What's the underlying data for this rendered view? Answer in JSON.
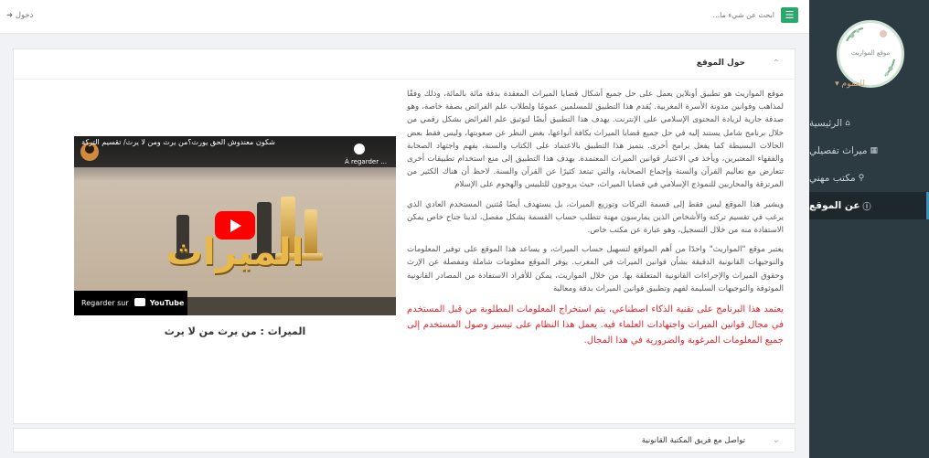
{
  "sidebar": {
    "logo_text": "موقع المواريث",
    "user_name": "للعموم",
    "items": [
      {
        "label": "الرئيسية",
        "icon": "home-icon"
      },
      {
        "label": "ميراث تفصيلي",
        "icon": "calculator-icon"
      },
      {
        "label": "مكتب مهني",
        "icon": "search-icon"
      },
      {
        "label": "عن الموقع",
        "icon": "info-icon",
        "active": true
      }
    ]
  },
  "topbar": {
    "search_placeholder": "ابحث عن شيء ما...",
    "login": "دخول"
  },
  "about": {
    "title": "حول الموقع",
    "paragraphs": [
      "موقع المواريث هو تطبيق أونلاين يعمل على حل جميع أشكال قضايا الميراث المعقدة بدقة مائة بالمائة، وذلك وفقًا لمذاهب وقوانين مدونة الأسرة المغربية. يُقدم هذا التطبيق للمسلمين عمومًا ولطلاب علم الفرائض بصفة خاصة، وهو صدقة جارية لزيادة المحتوى الإسلامي على الإنترنت. يهدف هذا التطبيق أيضًا لتوثيق علم الفرائض بشكل رقمي من خلال برنامج شامل يستند إليه في حل جميع قضايا الميراث بكافة أنواعها، بغض النظر عن صعوبتها، وليس فقط بعض الحالات البسيطة كما يفعل برامج أخرى. يتميز هذا التطبيق بالاعتماد على الكتاب والسنة، بفهم واجتهاد الصحابة والفقهاء المعتبرين، ويأخذ في الاعتبار قوانين الميراث المعتمدة. يهدف هذا التطبيق إلى منع استخدام تطبيقات أخرى تتعارض مع تعاليم القرآن والسنة وإجماع الصحابة، والتي تبتعد كثيرًا عن القرآن والسنة. لاحظ أن هناك الكثير من المرتزقة والمحاربين للنموذج الإسلامي في قضايا الميراث، حيث يروجون للتلبيس والهجوم على الإسلام",
      "ويشير هذا الموقع ليس فقط إلى قسمة التركات وتوزيع الميراث، بل يستهدف أيضًا مُثنين المستخدم العادي الذي يرغب في تقسيم تركته والأشخاص الذين يمارسون مهنة تتطلب حساب القسمة بشكل مفصل، لدينا جناح خاص يمكن الاستفادة منه من خلال التسجيل، وهو عبارة عن مكتب خاص.",
      "يعتبر موقع \"المواريث\" واحدًا من أهم المواقع لتسهيل حساب الميراث، و يساعد هذا الموقع على توفير المعلومات والتوجيهات القانونية الدقيقة بشأن قوانين الميراث في المغرب. يوفر الموقع معلومات شاملة ومفصلة عن الإرث وحقوق الميراث والإجراءات القانونية المتعلقة بها. من خلال المواريث، يمكن للأفراد الاستفادة من المصادر القانونية الموثوقة والتوجيهات السليمة لفهم وتطبيق قوانين الميراث بدقة ومعالية"
    ],
    "red_paragraph": "يعتمد هذا البرنامج على تقنية الذكاء اصطناعي، يتم استخراج المعلومات المطلوبة من قبل المستخدم في مجال قوانين الميراث واجتهادات العلماء فيه. يعمل هذا النظام على تيسير وصول المستخدم إلى جميع المعلومات المرغوبة والضرورية في هذا المجال."
  },
  "video": {
    "title": "شكون معندوش الحق يورث؟من يرث ومن لا يرث/ تقسيم التركة",
    "watch_later": "À regarder ...",
    "watch_on": "Regarder sur",
    "youtube": "YouTube",
    "thumb_text": "الميراث",
    "caption": "الميراث : من يرث من لا يرث"
  },
  "contact": {
    "title": "تواصل مع فريق المكتبة القانونية"
  },
  "colors": {
    "sidebar": "#2c3b41",
    "accent_green": "#2aa76a",
    "red_text": "#e6232a"
  }
}
